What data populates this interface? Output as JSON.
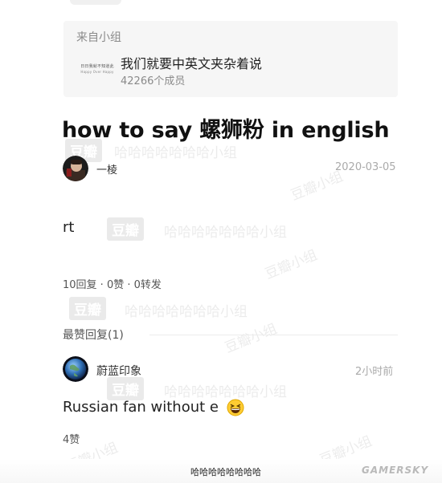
{
  "group": {
    "from_label": "来自小组",
    "logo_text_line1": "日日我就不知道此",
    "logo_text_line2": "Happy Over Happy",
    "name": "我们就要中英文夹杂着说",
    "members": "42266个成员"
  },
  "post": {
    "title": "how to say 螺狮粉 in english",
    "author": "一棱",
    "date": "2020-03-05",
    "body": "rt",
    "stats": "10回复 · 0赞 · 0转发"
  },
  "replies": {
    "section_title": "最赞回复(1)",
    "items": [
      {
        "user": "蔚蓝印象",
        "time": "2小时前",
        "text": "Russian fan without e",
        "likes": "4赞"
      }
    ]
  },
  "footer": {
    "caption": "哈哈哈哈哈哈哈哈",
    "site": "GAMERSKY"
  },
  "watermarks": {
    "stamp": "豆瓣",
    "haha": "哈哈哈哈哈哈哈小组",
    "corner": "豆瓣小组"
  },
  "icons": {
    "emoji": "grinning-squinting-face-icon"
  }
}
